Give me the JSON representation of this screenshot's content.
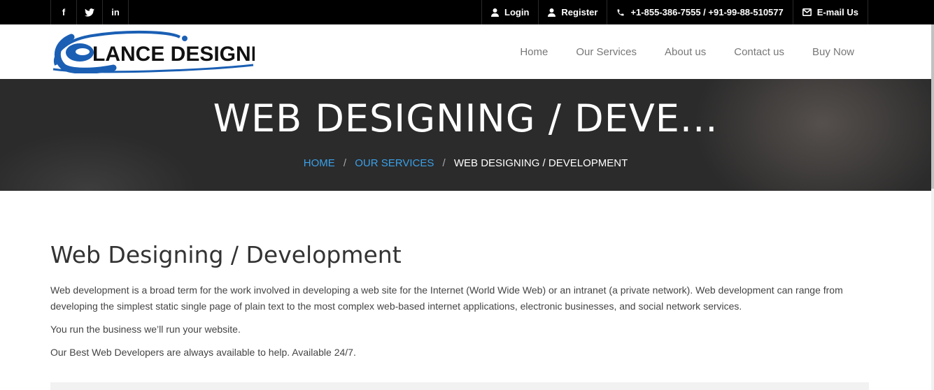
{
  "topbar": {
    "social": [
      {
        "icon": "facebook-icon",
        "glyph": "f"
      },
      {
        "icon": "twitter-icon",
        "glyph": "t"
      },
      {
        "icon": "linkedin-icon",
        "glyph": "in"
      }
    ],
    "login_label": "Login",
    "register_label": "Register",
    "phone_label": "+1-855-386-7555 / +91-99-88-510577",
    "email_label": "E-mail Us"
  },
  "header": {
    "logo_text": "LANCE DESIGNERS",
    "nav": [
      "Home",
      "Our Services",
      "About us",
      "Contact us",
      "Buy Now"
    ]
  },
  "hero": {
    "title": "WEB DESIGNING / DEVE...",
    "breadcrumb": {
      "home": "HOME",
      "services": "OUR SERVICES",
      "current": "WEB DESIGNING / DEVELOPMENT",
      "separator": "/"
    }
  },
  "content": {
    "heading": "Web Designing / Development",
    "paragraphs": [
      "Web development is a broad term for the work involved in developing a web site for the Internet (World Wide Web) or an intranet (a private network). Web development can range from developing the simplest static single page of plain text to the most complex web-based internet applications, electronic businesses, and social network services.",
      "You run the business we’ll run your website.",
      "Our Best Web Developers are always available to help. Available 24/7."
    ]
  },
  "colors": {
    "topbar_bg": "#000000",
    "hero_bg": "#2b2b2b",
    "link_blue": "#3aa0e8",
    "logo_blue": "#1a5fb4"
  }
}
